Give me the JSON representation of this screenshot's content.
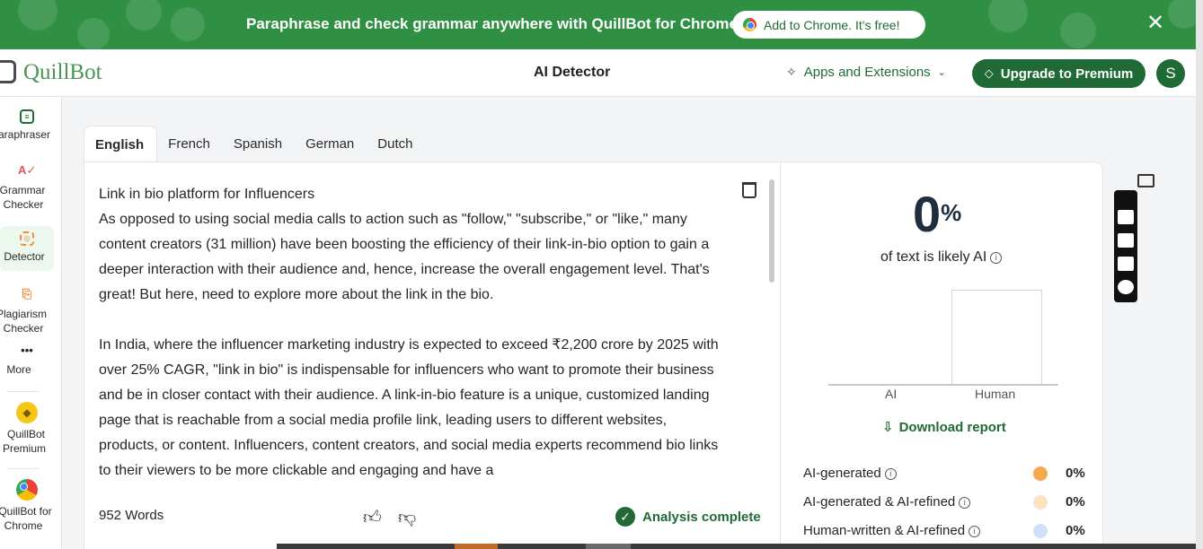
{
  "banner": {
    "text": "Paraphrase and check grammar anywhere with QuillBot for Chrome",
    "button": "Add to Chrome. It’s free!",
    "close": "✕"
  },
  "header": {
    "logo": "QuillBot",
    "title": "AI Detector",
    "apps_label": "Apps and Extensions",
    "upgrade_label": "Upgrade to Premium",
    "avatar_initial": "S"
  },
  "sidebar": {
    "items": [
      {
        "line1": "Paraphraser",
        "line2": ""
      },
      {
        "line1": "Grammar",
        "line2": "Checker"
      },
      {
        "line1": "Detector",
        "line2": ""
      },
      {
        "line1": "Plagiarism",
        "line2": "Checker"
      },
      {
        "line1": "More",
        "line2": ""
      },
      {
        "line1": "QuillBot",
        "line2": "Premium"
      },
      {
        "line1": "QuillBot for",
        "line2": "Chrome"
      }
    ]
  },
  "tabs": [
    "English",
    "French",
    "Spanish",
    "German",
    "Dutch"
  ],
  "editor": {
    "title_line": "Link in bio platform for Influencers",
    "paragraph1": "As opposed to using social media calls to action such as \"follow,\" \"subscribe,\" or \"like,\" many content creators (31 million) have been boosting the efficiency of their link-in-bio option to gain a deeper interaction with their audience and, hence, increase the overall engagement level. That's great! But here, need to explore more about the link in the bio.",
    "paragraph2": "In India, where the influencer marketing industry is expected to exceed ₹2,200 crore by 2025 with over 25% CAGR, \"link in bio\" is indispensable for influencers who want to promote their business and be in closer contact with their audience. A link-in-bio feature is a unique, customized landing page that is reachable from a social media profile link, leading users to different websites, products, or content. Influencers, content creators, and social media experts recommend bio links to their viewers to be more clickable and engaging and have a",
    "word_count": "952 Words",
    "status": "Analysis complete"
  },
  "results": {
    "percent": "0",
    "percent_sign": "%",
    "label": "of text is likely AI",
    "bar_labels": [
      "AI",
      "Human"
    ],
    "download": "Download report",
    "legend": [
      {
        "label": "AI-generated",
        "value": "0%",
        "color": "#f4a94f"
      },
      {
        "label": "AI-generated & AI-refined",
        "value": "0%",
        "color": "#fbe3c2"
      },
      {
        "label": "Human-written & AI-refined",
        "value": "0%",
        "color": "#cfe0fb"
      }
    ]
  },
  "colors": {
    "brand_green": "#1f6a35",
    "banner_green": "#2f8f43"
  }
}
